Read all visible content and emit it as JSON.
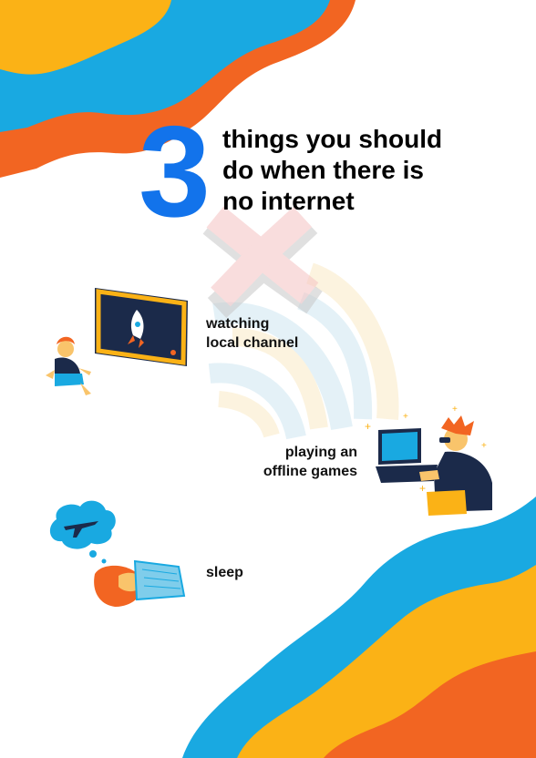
{
  "headline": {
    "number": "3",
    "lines": [
      "things you should",
      "do when there is",
      "no internet"
    ]
  },
  "activities": [
    {
      "lines": [
        "watching",
        "local channel"
      ],
      "icon": "tv-rocket-icon"
    },
    {
      "lines": [
        "playing an",
        "offline games"
      ],
      "icon": "laptop-gamer-icon"
    },
    {
      "lines": [
        "sleep"
      ],
      "icon": "sleeping-cloud-icon"
    }
  ],
  "colors": {
    "blue": "#19A9E1",
    "orange": "#F26522",
    "yellow": "#FBB216",
    "accent_number": "#1273EB"
  }
}
